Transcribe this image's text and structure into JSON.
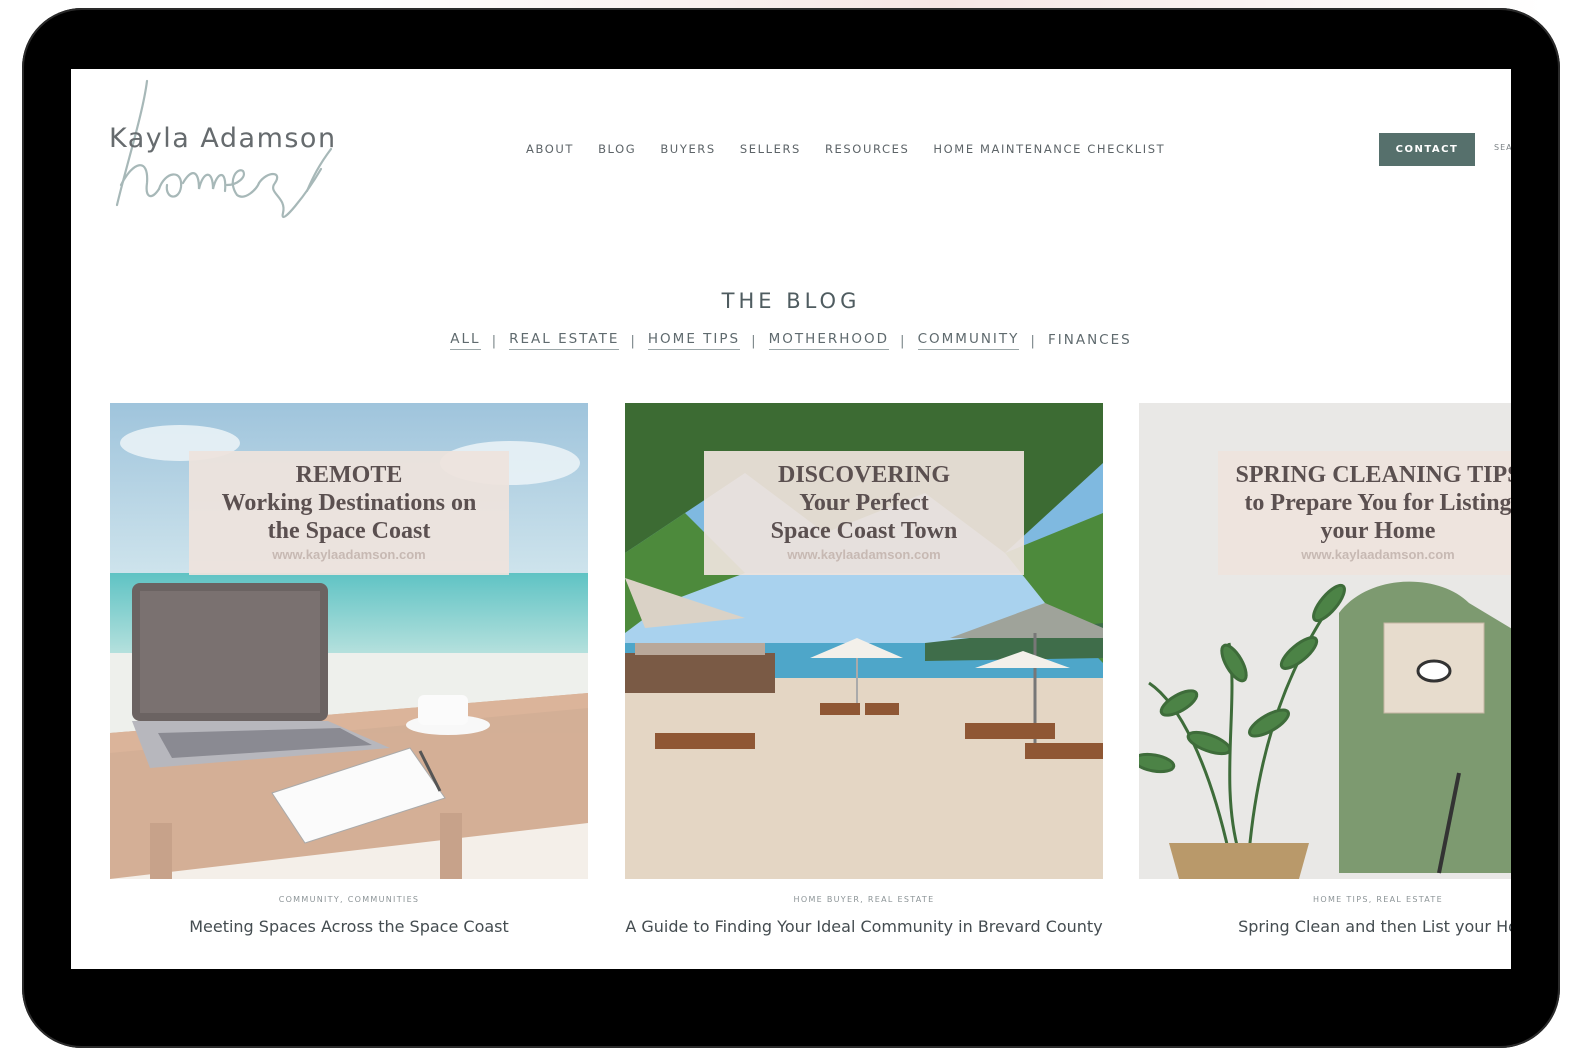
{
  "logo": {
    "name": "Kayla Adamson",
    "script": "homes"
  },
  "nav": [
    "ABOUT",
    "BLOG",
    "BUYERS",
    "SELLERS",
    "RESOURCES",
    "HOME MAINTENANCE CHECKLIST"
  ],
  "contact_label": "CONTACT",
  "search_peek": "SEA",
  "blog": {
    "title": "THE BLOG",
    "filters": [
      "ALL",
      "REAL ESTATE",
      "HOME TIPS",
      "MOTHERHOOD",
      "COMMUNITY",
      "FINANCES"
    ],
    "separator": "|"
  },
  "cards": [
    {
      "image_lines": [
        "REMOTE",
        "Working Destinations on",
        "the Space Coast"
      ],
      "image_url": "www.kaylaadamson.com",
      "category": "COMMUNITY, COMMUNITIES",
      "title": "Meeting Spaces Across the Space Coast"
    },
    {
      "image_lines": [
        "DISCOVERING",
        "Your Perfect",
        "Space Coast Town"
      ],
      "image_url": "www.kaylaadamson.com",
      "category": "HOME BUYER, REAL ESTATE",
      "title": "A Guide to Finding Your Ideal Community in Brevard County"
    },
    {
      "image_lines": [
        "SPRING CLEANING TIPS",
        "to Prepare You for Listing",
        "your Home"
      ],
      "image_url": "www.kaylaadamson.com",
      "category": "HOME TIPS, REAL ESTATE",
      "title": "Spring Clean and then List your Ho"
    }
  ],
  "colors": {
    "accent": "#56706c",
    "text": "#5d6468",
    "device": "#000000",
    "title_box": "#eee3dd"
  }
}
